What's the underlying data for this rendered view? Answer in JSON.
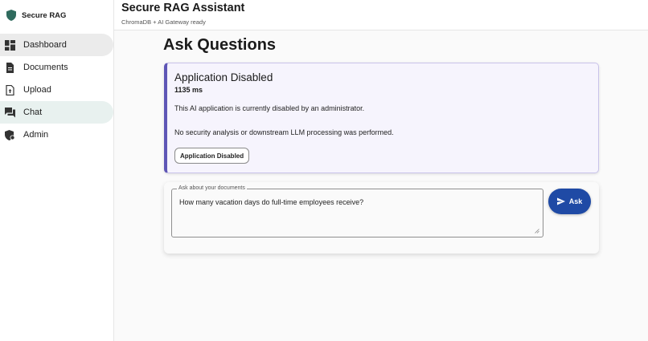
{
  "sidebar": {
    "brand": {
      "icon": "shield-icon",
      "name": "Secure RAG"
    },
    "items": [
      {
        "label": "Dashboard",
        "icon": "dashboard-icon"
      },
      {
        "label": "Documents",
        "icon": "document-icon"
      },
      {
        "label": "Upload",
        "icon": "upload-icon"
      },
      {
        "label": "Chat",
        "icon": "chat-icon"
      },
      {
        "label": "Admin",
        "icon": "admin-shield-icon"
      }
    ]
  },
  "header": {
    "title": "Secure RAG Assistant",
    "subtitle": "ChromaDB + AI Gateway ready"
  },
  "main": {
    "title": "Ask Questions",
    "alert": {
      "title": "Application Disabled",
      "latency": "1135 ms",
      "message_1": "This AI application is currently disabled by an administrator.",
      "message_2": "No security analysis or downstream LLM processing was performed.",
      "chip": "Application Disabled"
    },
    "query": {
      "label": "Ask about your documents",
      "value": "How many vacation days do full-time employees receive?",
      "button_label": "Ask",
      "button_icon": "send-icon"
    }
  },
  "colors": {
    "brand_green": "#2f6b5e",
    "ask_button": "#1f4aa5",
    "alert_accent": "#5e56b6",
    "alert_background": "#f6f4fd"
  }
}
